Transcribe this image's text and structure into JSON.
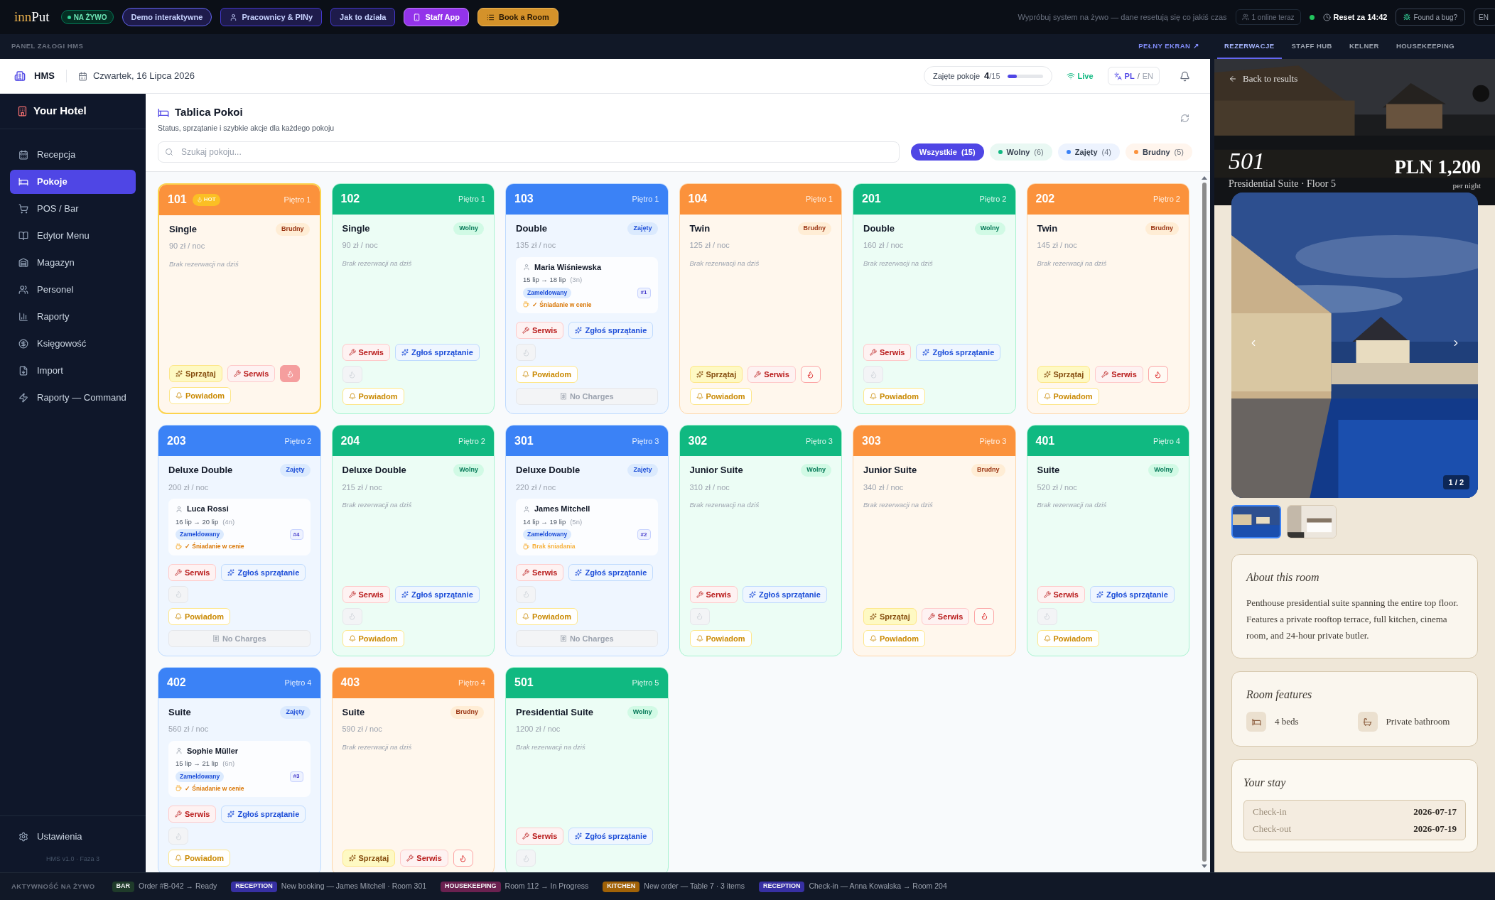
{
  "top_bar": {
    "logo_first": "inn",
    "logo_second": "Put",
    "live_badge": "NA ŻYWO",
    "buttons": [
      {
        "label": "Demo interaktywne",
        "kind": "demo"
      },
      {
        "label": "Pracownicy & PINy",
        "kind": "staff"
      },
      {
        "label": "Jak to działa",
        "kind": "howto"
      },
      {
        "label": "Staff App",
        "kind": "app"
      },
      {
        "label": "Book a Room",
        "kind": "book"
      }
    ],
    "notice": "Wypróbuj system na żywo — dane resetują się co jakiś czas",
    "online": "1 online teraz",
    "reset": "Reset za 14:42",
    "bug": "Found a bug?",
    "lang": "EN"
  },
  "panel_bar": {
    "title": "PANEL ZAŁOGI HMS",
    "fullscreen": "PEŁNY EKRAN ↗"
  },
  "header": {
    "app": "HMS",
    "date": "Czwartek, 16 Lipca 2026",
    "occupancy": {
      "label": "Zajęte pokoje",
      "value": "4",
      "total": "/15",
      "level": 0.27
    },
    "live": "Live",
    "languages": [
      {
        "label": "PL",
        "selected": true
      },
      {
        "label": "EN",
        "selected": false
      }
    ],
    "separator": "/"
  },
  "sidebar": {
    "hotel": "Your Hotel",
    "items": [
      {
        "label": "Recepcja",
        "kind": "calendar",
        "selected": false
      },
      {
        "label": "Pokoje",
        "kind": "bed",
        "selected": true
      },
      {
        "label": "POS / Bar",
        "kind": "cart",
        "selected": false
      },
      {
        "label": "Edytor Menu",
        "kind": "book",
        "selected": false
      },
      {
        "label": "Magazyn",
        "kind": "warehouse",
        "selected": false
      },
      {
        "label": "Personel",
        "kind": "users",
        "selected": false
      },
      {
        "label": "Raporty",
        "kind": "chart",
        "selected": false
      },
      {
        "label": "Księgowość",
        "kind": "money",
        "selected": false
      },
      {
        "label": "Import",
        "kind": "import",
        "selected": false
      },
      {
        "label": "Raporty — Command",
        "kind": "bolt",
        "selected": false
      }
    ],
    "settings": "Ustawienia",
    "version": "HMS v1.0 · Faza 3"
  },
  "board": {
    "title": "Tablica Pokoi",
    "subtitle": "Status, sprzątanie i szybkie akcje dla każdego pokoju",
    "search": {
      "placeholder": "Szukaj pokoju..."
    },
    "filters": [
      {
        "label": "Wszystkie",
        "count": "(15)",
        "selected": true
      },
      {
        "label": "Wolny",
        "count": "(6)",
        "selected": false,
        "color": "#10b981"
      },
      {
        "label": "Zajęty",
        "count": "(4)",
        "selected": false,
        "color": "#3b82f6"
      },
      {
        "label": "Brudny",
        "count": "(5)",
        "selected": false,
        "color": "#fb923c"
      }
    ],
    "rooms": [
      {
        "number": "101",
        "hot_label": "HOT",
        "floor": "Piętro 1",
        "type": "Single",
        "kind": "dirty",
        "status_label": "Brudny",
        "price": "90 zł / noc",
        "no_booking": "Brak rezerwacji na dziś",
        "actions": [
          {
            "kind": "clean",
            "label": "Sprzątaj"
          },
          {
            "kind": "service",
            "label": "Serwis"
          },
          {
            "kind": "flame",
            "on": true,
            "disabled": false
          },
          {
            "kind": "notify",
            "label": "Powiadom"
          }
        ]
      },
      {
        "number": "102",
        "floor": "Piętro 1",
        "type": "Single",
        "kind": "free",
        "status_label": "Wolny",
        "price": "90 zł / noc",
        "no_booking": "Brak rezerwacji na dziś",
        "actions": [
          {
            "kind": "service",
            "label": "Serwis"
          },
          {
            "kind": "report",
            "label": "Zgłoś sprzątanie"
          },
          {
            "kind": "flame",
            "on": false,
            "disabled": true
          },
          {
            "kind": "notify",
            "label": "Powiadom"
          }
        ]
      },
      {
        "number": "103",
        "floor": "Piętro 1",
        "type": "Double",
        "kind": "occupied",
        "status_label": "Zajęty",
        "price": "135 zł / noc",
        "booking": {
          "guest": "Maria Wiśniewska",
          "dates": "15 lip → 18 lip",
          "nights": "(3n)",
          "state": "Zameldowany",
          "ref": "#1",
          "breakfast": "✓ Śniadanie w cenie",
          "breakfast_included": true
        },
        "actions": [
          {
            "kind": "service",
            "label": "Serwis"
          },
          {
            "kind": "report",
            "label": "Zgłoś sprzątanie"
          },
          {
            "kind": "flame",
            "on": false,
            "disabled": true
          },
          {
            "kind": "notify",
            "label": "Powiadom"
          },
          {
            "kind": "nocharges",
            "label": "No Charges"
          }
        ]
      },
      {
        "number": "104",
        "floor": "Piętro 1",
        "type": "Twin",
        "kind": "dirty",
        "status_label": "Brudny",
        "price": "125 zł / noc",
        "no_booking": "Brak rezerwacji na dziś",
        "actions": [
          {
            "kind": "clean",
            "label": "Sprzątaj"
          },
          {
            "kind": "service",
            "label": "Serwis"
          },
          {
            "kind": "flame",
            "on": false,
            "disabled": false
          },
          {
            "kind": "notify",
            "label": "Powiadom"
          }
        ]
      },
      {
        "number": "201",
        "floor": "Piętro 2",
        "type": "Double",
        "kind": "free",
        "status_label": "Wolny",
        "price": "160 zł / noc",
        "no_booking": "Brak rezerwacji na dziś",
        "actions": [
          {
            "kind": "service",
            "label": "Serwis"
          },
          {
            "kind": "report",
            "label": "Zgłoś sprzątanie"
          },
          {
            "kind": "flame",
            "on": false,
            "disabled": true
          },
          {
            "kind": "notify",
            "label": "Powiadom"
          }
        ]
      },
      {
        "number": "202",
        "floor": "Piętro 2",
        "type": "Twin",
        "kind": "dirty",
        "status_label": "Brudny",
        "price": "145 zł / noc",
        "no_booking": "Brak rezerwacji na dziś",
        "actions": [
          {
            "kind": "clean",
            "label": "Sprzątaj"
          },
          {
            "kind": "service",
            "label": "Serwis"
          },
          {
            "kind": "flame",
            "on": false,
            "disabled": false
          },
          {
            "kind": "notify",
            "label": "Powiadom"
          }
        ]
      },
      {
        "number": "203",
        "floor": "Piętro 2",
        "type": "Deluxe Double",
        "kind": "occupied",
        "status_label": "Zajęty",
        "price": "200 zł / noc",
        "booking": {
          "guest": "Luca Rossi",
          "dates": "16 lip → 20 lip",
          "nights": "(4n)",
          "state": "Zameldowany",
          "ref": "#4",
          "breakfast": "✓ Śniadanie w cenie",
          "breakfast_included": true
        },
        "actions": [
          {
            "kind": "service",
            "label": "Serwis"
          },
          {
            "kind": "report",
            "label": "Zgłoś sprzątanie"
          },
          {
            "kind": "flame",
            "on": false,
            "disabled": true
          },
          {
            "kind": "notify",
            "label": "Powiadom"
          },
          {
            "kind": "nocharges",
            "label": "No Charges"
          }
        ]
      },
      {
        "number": "204",
        "floor": "Piętro 2",
        "type": "Deluxe Double",
        "kind": "free",
        "status_label": "Wolny",
        "price": "215 zł / noc",
        "no_booking": "Brak rezerwacji na dziś",
        "actions": [
          {
            "kind": "service",
            "label": "Serwis"
          },
          {
            "kind": "report",
            "label": "Zgłoś sprzątanie"
          },
          {
            "kind": "flame",
            "on": false,
            "disabled": true
          },
          {
            "kind": "notify",
            "label": "Powiadom"
          }
        ]
      },
      {
        "number": "301",
        "floor": "Piętro 3",
        "type": "Deluxe Double",
        "kind": "occupied",
        "status_label": "Zajęty",
        "price": "220 zł / noc",
        "booking": {
          "guest": "James Mitchell",
          "dates": "14 lip → 19 lip",
          "nights": "(5n)",
          "state": "Zameldowany",
          "ref": "#2",
          "breakfast": "Brak śniadania",
          "breakfast_included": false
        },
        "actions": [
          {
            "kind": "service",
            "label": "Serwis"
          },
          {
            "kind": "report",
            "label": "Zgłoś sprzątanie"
          },
          {
            "kind": "flame",
            "on": false,
            "disabled": true
          },
          {
            "kind": "notify",
            "label": "Powiadom"
          },
          {
            "kind": "nocharges",
            "label": "No Charges"
          }
        ]
      },
      {
        "number": "302",
        "floor": "Piętro 3",
        "type": "Junior Suite",
        "kind": "free",
        "status_label": "Wolny",
        "price": "310 zł / noc",
        "no_booking": "Brak rezerwacji na dziś",
        "actions": [
          {
            "kind": "service",
            "label": "Serwis"
          },
          {
            "kind": "report",
            "label": "Zgłoś sprzątanie"
          },
          {
            "kind": "flame",
            "on": false,
            "disabled": true
          },
          {
            "kind": "notify",
            "label": "Powiadom"
          }
        ]
      },
      {
        "number": "303",
        "floor": "Piętro 3",
        "type": "Junior Suite",
        "kind": "dirty",
        "status_label": "Brudny",
        "price": "340 zł / noc",
        "no_booking": "Brak rezerwacji na dziś",
        "actions": [
          {
            "kind": "clean",
            "label": "Sprzątaj"
          },
          {
            "kind": "service",
            "label": "Serwis"
          },
          {
            "kind": "flame",
            "on": false,
            "disabled": false
          },
          {
            "kind": "notify",
            "label": "Powiadom"
          }
        ]
      },
      {
        "number": "401",
        "floor": "Piętro 4",
        "type": "Suite",
        "kind": "free",
        "status_label": "Wolny",
        "price": "520 zł / noc",
        "no_booking": "Brak rezerwacji na dziś",
        "actions": [
          {
            "kind": "service",
            "label": "Serwis"
          },
          {
            "kind": "report",
            "label": "Zgłoś sprzątanie"
          },
          {
            "kind": "flame",
            "on": false,
            "disabled": true
          },
          {
            "kind": "notify",
            "label": "Powiadom"
          }
        ]
      },
      {
        "number": "402",
        "floor": "Piętro 4",
        "type": "Suite",
        "kind": "occupied",
        "status_label": "Zajęty",
        "price": "560 zł / noc",
        "booking": {
          "guest": "Sophie Müller",
          "dates": "15 lip → 21 lip",
          "nights": "(6n)",
          "state": "Zameldowany",
          "ref": "#3",
          "breakfast": "✓ Śniadanie w cenie",
          "breakfast_included": true
        },
        "actions": [
          {
            "kind": "service",
            "label": "Serwis"
          },
          {
            "kind": "report",
            "label": "Zgłoś sprzątanie"
          },
          {
            "kind": "flame",
            "on": false,
            "disabled": true
          },
          {
            "kind": "notify",
            "label": "Powiadom"
          }
        ]
      },
      {
        "number": "403",
        "floor": "Piętro 4",
        "type": "Suite",
        "kind": "dirty",
        "status_label": "Brudny",
        "price": "590 zł / noc",
        "no_booking": "Brak rezerwacji na dziś",
        "actions": [
          {
            "kind": "clean",
            "label": "Sprzątaj"
          },
          {
            "kind": "service",
            "label": "Serwis"
          },
          {
            "kind": "flame",
            "on": false,
            "disabled": false
          }
        ]
      },
      {
        "number": "501",
        "floor": "Piętro 5",
        "type": "Presidential Suite",
        "kind": "free",
        "status_label": "Wolny",
        "price": "1200 zł / noc",
        "no_booking": "Brak rezerwacji na dziś",
        "actions": [
          {
            "kind": "service",
            "label": "Serwis"
          },
          {
            "kind": "report",
            "label": "Zgłoś sprzątanie"
          },
          {
            "kind": "flame",
            "on": false,
            "disabled": true
          }
        ]
      }
    ]
  },
  "right_panel": {
    "tabs": [
      {
        "label": "REZERWACJE",
        "selected": true
      },
      {
        "label": "STAFF HUB",
        "selected": false
      },
      {
        "label": "KELNER",
        "selected": false
      },
      {
        "label": "HOUSEKEEPING",
        "selected": false
      }
    ],
    "back": "Back to results",
    "room": "501",
    "subtitle": "Presidential Suite · Floor 5",
    "price": "PLN 1,200",
    "per": "per night",
    "counter": "1 / 2",
    "thumbnails": [
      {
        "selected": true
      },
      {
        "selected": false
      }
    ],
    "about": {
      "title": "About this room",
      "text": "Penthouse presidential suite spanning the entire top floor. Features a private rooftop terrace, full kitchen, cinema room, and 24-hour private butler."
    },
    "features": {
      "title": "Room features",
      "items": [
        {
          "label": "4 beds",
          "kind": "bed"
        },
        {
          "label": "Private bathroom",
          "kind": "bath"
        }
      ]
    },
    "stay": {
      "title": "Your stay",
      "rows": [
        {
          "label": "Check-in",
          "value": "2026-07-17"
        },
        {
          "label": "Check-out",
          "value": "2026-07-19"
        }
      ]
    }
  },
  "activity": {
    "title": "AKTYWNOŚĆ NA ŻYWO",
    "events": [
      {
        "tag": "BAR",
        "text": "Order #B-042 → Ready",
        "color": "#1f3b2a"
      },
      {
        "tag": "RECEPTION",
        "text": "New booking — James Mitchell · Room 301",
        "color": "#3730a3"
      },
      {
        "tag": "HOUSEKEEPING",
        "text": "Room 112 → In Progress",
        "color": "#6b2150"
      },
      {
        "tag": "KITCHEN",
        "text": "New order — Table 7 · 3 items",
        "color": "#a16207"
      },
      {
        "tag": "RECEPTION",
        "text": "Check-in — Anna Kowalska → Room 204",
        "color": "#3730a3"
      }
    ]
  }
}
